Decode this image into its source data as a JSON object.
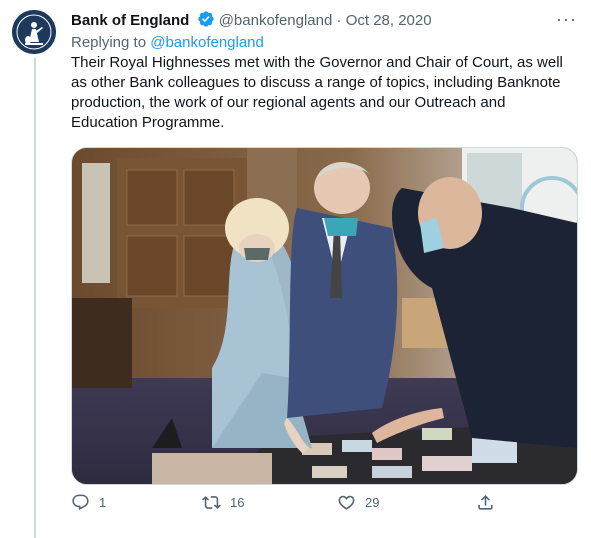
{
  "tweet": {
    "author_name": "Bank of England",
    "author_handle": "@bankofengland",
    "separator": "·",
    "date": "Oct 28, 2020",
    "replying_prefix": "Replying to ",
    "replying_to": "@bankofengland",
    "text": "Their Royal Highnesses met with the Governor and Chair of Court, as well\nas other Bank colleagues to discuss a range of topics, including Banknote\nproduction, the work of our regional agents and our Outreach and\nEducation Programme.",
    "more_label": "···"
  },
  "actions": {
    "reply_count": "1",
    "retweet_count": "16",
    "like_count": "29"
  },
  "icons": {
    "verified": "verified-badge-icon",
    "reply": "reply-icon",
    "retweet": "retweet-icon",
    "like": "heart-icon",
    "share": "share-icon"
  },
  "colors": {
    "accent": "#1d9bf0",
    "secondary_text": "#536471",
    "primary_text": "#0f1419"
  }
}
